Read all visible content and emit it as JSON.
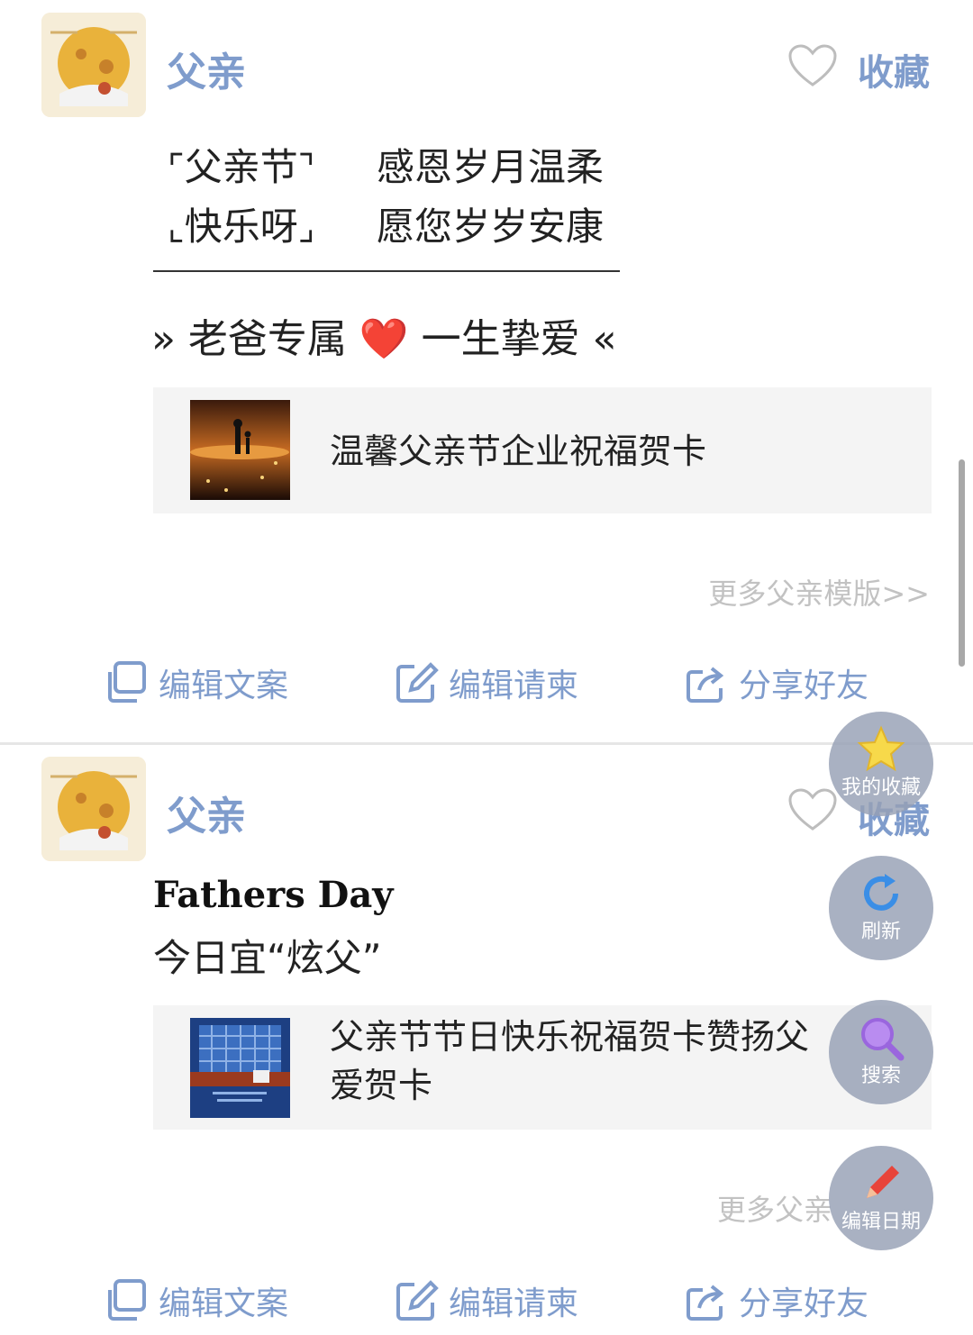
{
  "posts": [
    {
      "username": "父亲",
      "fav_label": "收藏",
      "lines": [
        {
          "left": "父亲节",
          "right": "感恩岁月温柔"
        },
        {
          "left": "快乐呀",
          "right": "愿您岁岁安康"
        }
      ],
      "slogan": "» 老爸专属 ❤️ 一生挚爱 «",
      "card_title": "温馨父亲节企业祝福贺卡",
      "more": "更多父亲模版>>",
      "actions": {
        "edit_copy": "编辑文案",
        "edit_invite": "编辑请柬",
        "share": "分享好友"
      }
    },
    {
      "username": "父亲",
      "fav_label": "收藏",
      "title_en": "Fathers Day",
      "subtitle": "今日宜“炫父”",
      "card_title": "父亲节节日快乐祝福贺卡赞扬父爱贺卡",
      "more": "更多父亲",
      "actions": {
        "edit_copy": "编辑文案",
        "edit_invite": "编辑请柬",
        "share": "分享好友"
      }
    }
  ],
  "fabs": {
    "favorites": "我的收藏",
    "refresh": "刷新",
    "search": "搜索",
    "edit_date": "编辑日期"
  },
  "colors": {
    "accent": "#7f9ccc",
    "muted": "#c2c2c2"
  },
  "icons": [
    "avatar-illustration",
    "heart-icon",
    "copy-icon",
    "edit-icon",
    "share-icon",
    "star-icon",
    "refresh-icon",
    "search-icon",
    "pencil-icon"
  ]
}
